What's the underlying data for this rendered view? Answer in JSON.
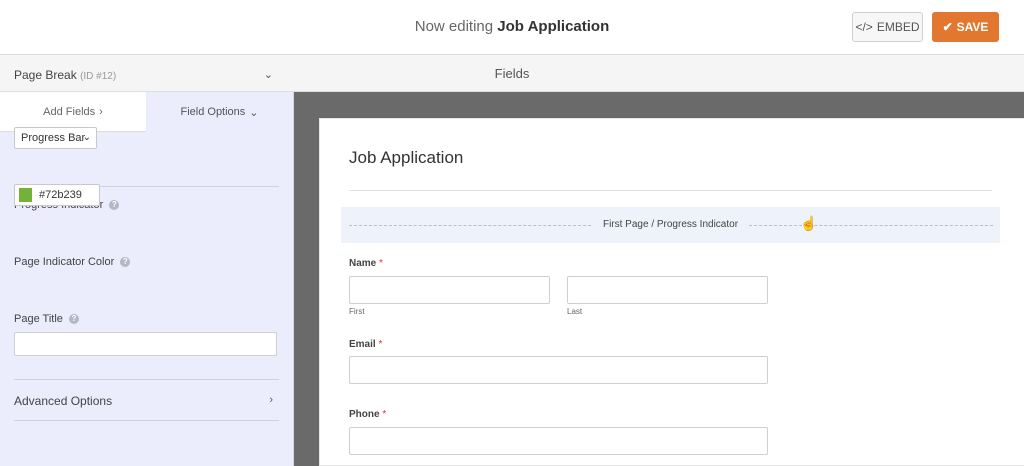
{
  "header": {
    "title_prefix": "Now editing",
    "form_name": "Job Application",
    "embed_label": "EMBED",
    "save_label": "SAVE"
  },
  "fields_bar": {
    "label": "Fields"
  },
  "sidebar": {
    "tabs": [
      {
        "label": "Add Fields",
        "icon": "chevron-right-icon"
      },
      {
        "label": "Field Options",
        "icon": "chevron-down-icon"
      }
    ],
    "page_break": {
      "title": "Page Break",
      "id_label": "(ID #12)"
    },
    "progress_indicator": {
      "label": "Progress Indicator",
      "selected": "Progress Bar"
    },
    "page_indicator_color": {
      "label": "Page Indicator Color",
      "value": "#72b239",
      "swatch_color": "#72b239"
    },
    "page_title": {
      "label": "Page Title",
      "value": ""
    },
    "advanced_options": {
      "label": "Advanced Options"
    }
  },
  "form": {
    "title": "Job Application",
    "page_break_label": "First Page / Progress Indicator",
    "fields": {
      "name": {
        "label": "Name",
        "required_mark": "*",
        "first_label": "First",
        "last_label": "Last"
      },
      "email": {
        "label": "Email",
        "required_mark": "*"
      },
      "phone": {
        "label": "Phone",
        "required_mark": "*"
      }
    }
  },
  "colors": {
    "accent": "#e27730",
    "sidebar_bg": "#ebedfc",
    "canvas_bg": "#6a6a6a",
    "required": "#d63638"
  }
}
